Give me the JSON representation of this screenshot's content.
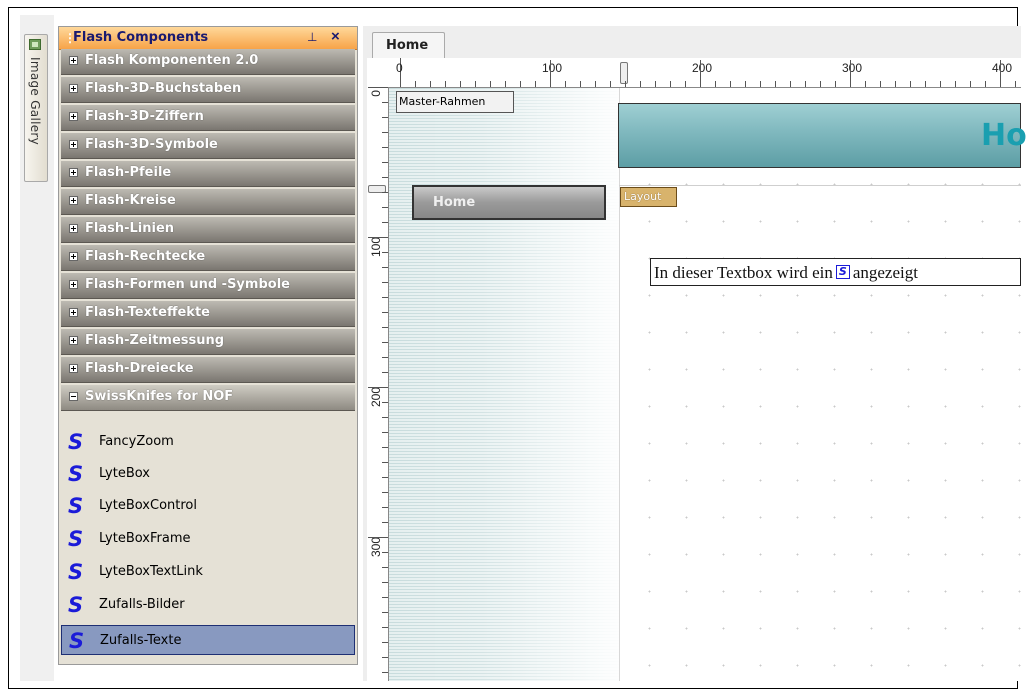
{
  "gallery": {
    "label": "Image Gallery"
  },
  "panel": {
    "title": "Flash Components",
    "groups": [
      "Flash Komponenten 2.0",
      "Flash-3D-Buchstaben",
      "Flash-3D-Ziffern",
      "Flash-3D-Symbole",
      "Flash-Pfeile",
      "Flash-Kreise",
      "Flash-Linien",
      "Flash-Rechtecke",
      "Flash-Formen und -Symbole",
      "Flash-Texteffekte",
      "Flash-Zeitmessung",
      "Flash-Dreiecke",
      "SwissKnifes for NOF"
    ],
    "items": [
      "FancyZoom",
      "LyteBox",
      "LyteBoxControl",
      "LyteBoxFrame",
      "LyteBoxTextLink",
      "Zufalls-Bilder",
      "Zufalls-Texte"
    ],
    "selected_item": "Zufalls-Texte"
  },
  "editor": {
    "tab": "Home",
    "ruler_h": [
      "0",
      "100",
      "200",
      "300",
      "400"
    ],
    "ruler_v": [
      "0",
      "100",
      "200",
      "300"
    ],
    "master_label": "Master-Rahmen",
    "banner_text": "Ho",
    "home_button": "Home",
    "layout_label": "Layout",
    "textbox": {
      "before": "In dieser Textbox wird ein",
      "icon": "S",
      "after": "angezeigt"
    }
  },
  "icons": {
    "pin": "pin-icon",
    "close": "close-icon",
    "component": "swissknife-s-icon"
  },
  "colors": {
    "panel_header": "#f7a348",
    "selected_item": "#8899c0",
    "banner": "#7fb8be",
    "banner_text": "#1a9fb0",
    "layout_tag": "#d8b36c"
  }
}
